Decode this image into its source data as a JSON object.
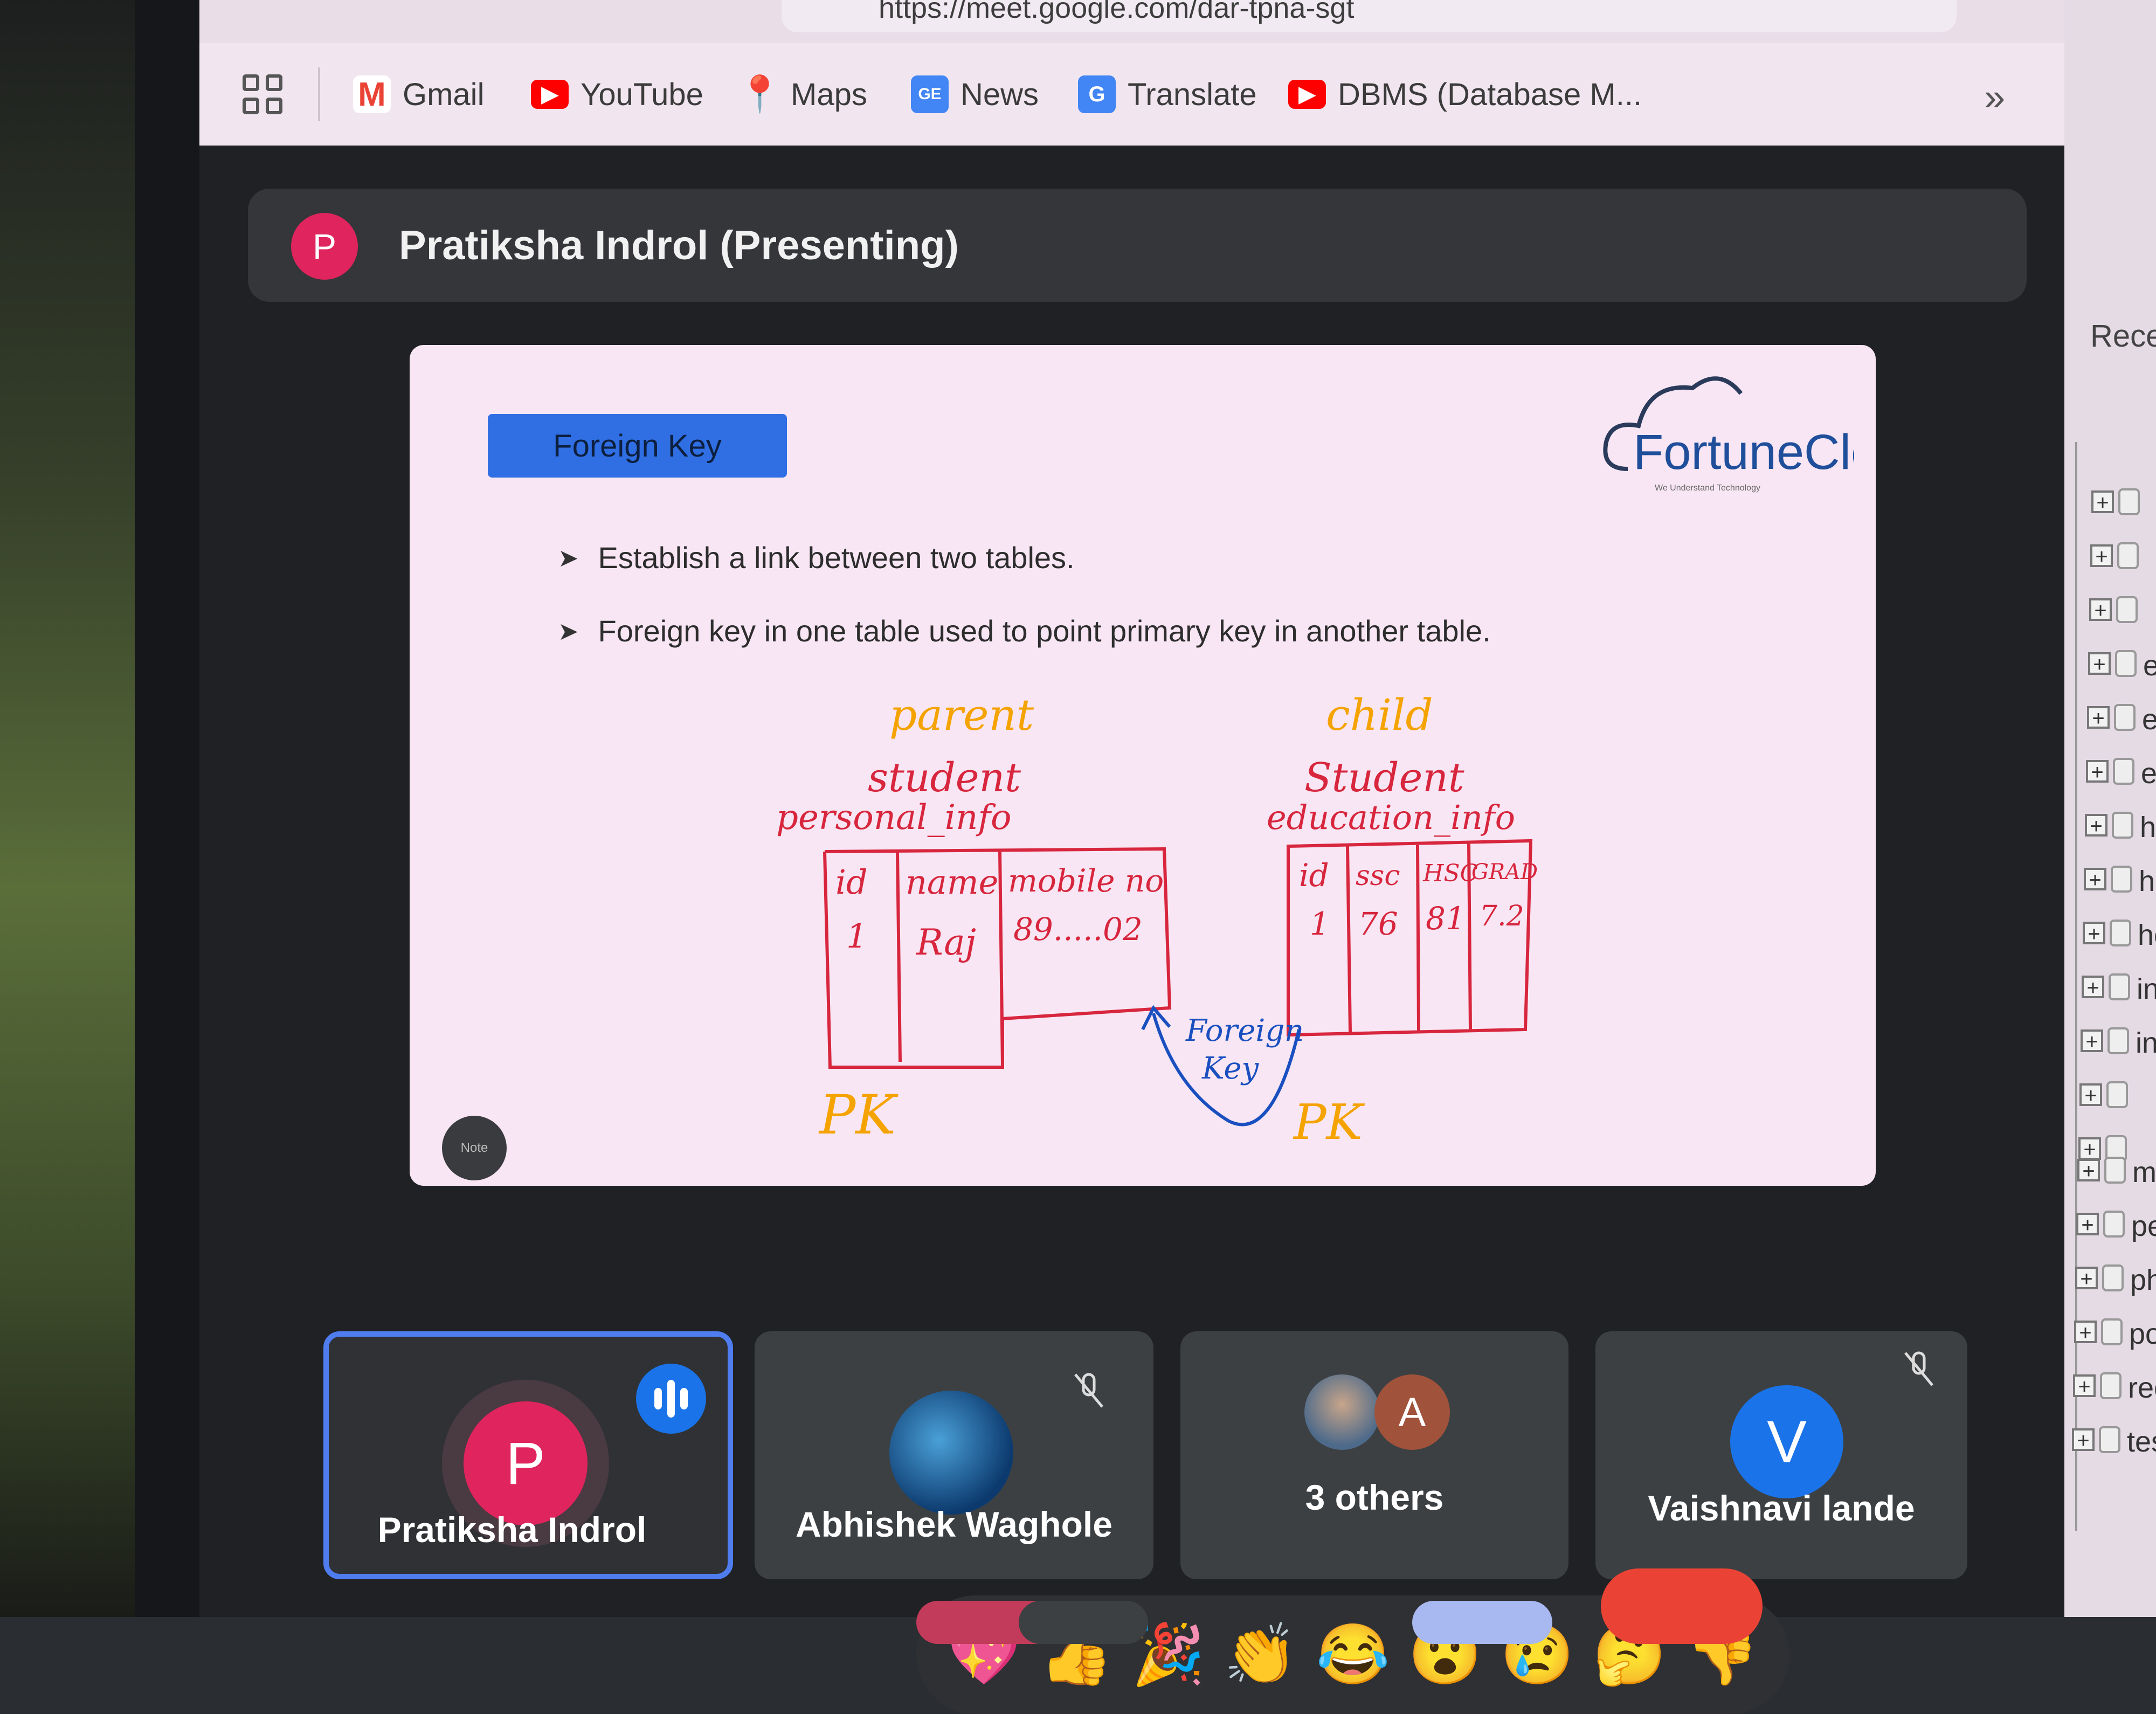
{
  "browser": {
    "url": "https://meet.google.com/dar-tpna-sgt",
    "bookmarks": [
      {
        "label": "Gmail",
        "icon": "gmail-icon",
        "color": "#ea4335"
      },
      {
        "label": "YouTube",
        "icon": "youtube-icon",
        "color": "#ff0000"
      },
      {
        "label": "Maps",
        "icon": "maps-icon",
        "color": "#34a853"
      },
      {
        "label": "News",
        "icon": "news-icon",
        "color": "#4285f4"
      },
      {
        "label": "Translate",
        "icon": "translate-icon",
        "color": "#4285f4"
      },
      {
        "label": "DBMS (Database M...",
        "icon": "youtube-icon",
        "color": "#ff0000"
      }
    ],
    "more_label": "»"
  },
  "presenter": {
    "initial": "P",
    "label": "Pratiksha Indrol (Presenting)"
  },
  "slide": {
    "title": "Foreign Key",
    "logo_text": "FortuneCloud",
    "logo_tagline": "We Understand Technology",
    "bullets": [
      "Establish a link between two tables.",
      "Foreign key in one table used to point primary key in another table."
    ],
    "annotations": {
      "parent": "parent",
      "parent_table_1": "student",
      "parent_table_2": "personal_info",
      "parent_cols": [
        "id",
        "name",
        "mobile no"
      ],
      "parent_row": [
        "1",
        "Raj",
        "89.....02"
      ],
      "child": "child",
      "child_table_1": "Student",
      "child_table_2": "education_info",
      "child_cols": [
        "id",
        "ssc",
        "HSC",
        "GRAD"
      ],
      "child_row": [
        "1",
        "76",
        "81",
        "7.2"
      ],
      "pk_left": "PK",
      "pk_right": "PK",
      "fk_label_1": "Foreign",
      "fk_label_2": "Key"
    },
    "note_label": "Note"
  },
  "participants": [
    {
      "name": "Pratiksha Indrol",
      "initial": "P",
      "color": "#e0245e",
      "speaking": true
    },
    {
      "name": "Abhishek Waghole",
      "muted": true
    },
    {
      "name": "3 others",
      "initial": "A",
      "color": "#a0523a"
    },
    {
      "name": "Vaishnavi lande",
      "initial": "V",
      "color": "#1a73e8",
      "muted": true
    }
  ],
  "reactions": [
    "💖",
    "👍",
    "🎉",
    "👏",
    "😂",
    "😮",
    "😢",
    "🤔",
    "👎"
  ],
  "side_panel": {
    "recent_label": "Rece",
    "tree_items": [
      "",
      "",
      "",
      "e",
      "e",
      "e",
      "h",
      "h",
      "he",
      "in",
      "ins",
      "",
      "",
      "my",
      "per",
      "php",
      "port",
      "reco",
      "test"
    ]
  }
}
